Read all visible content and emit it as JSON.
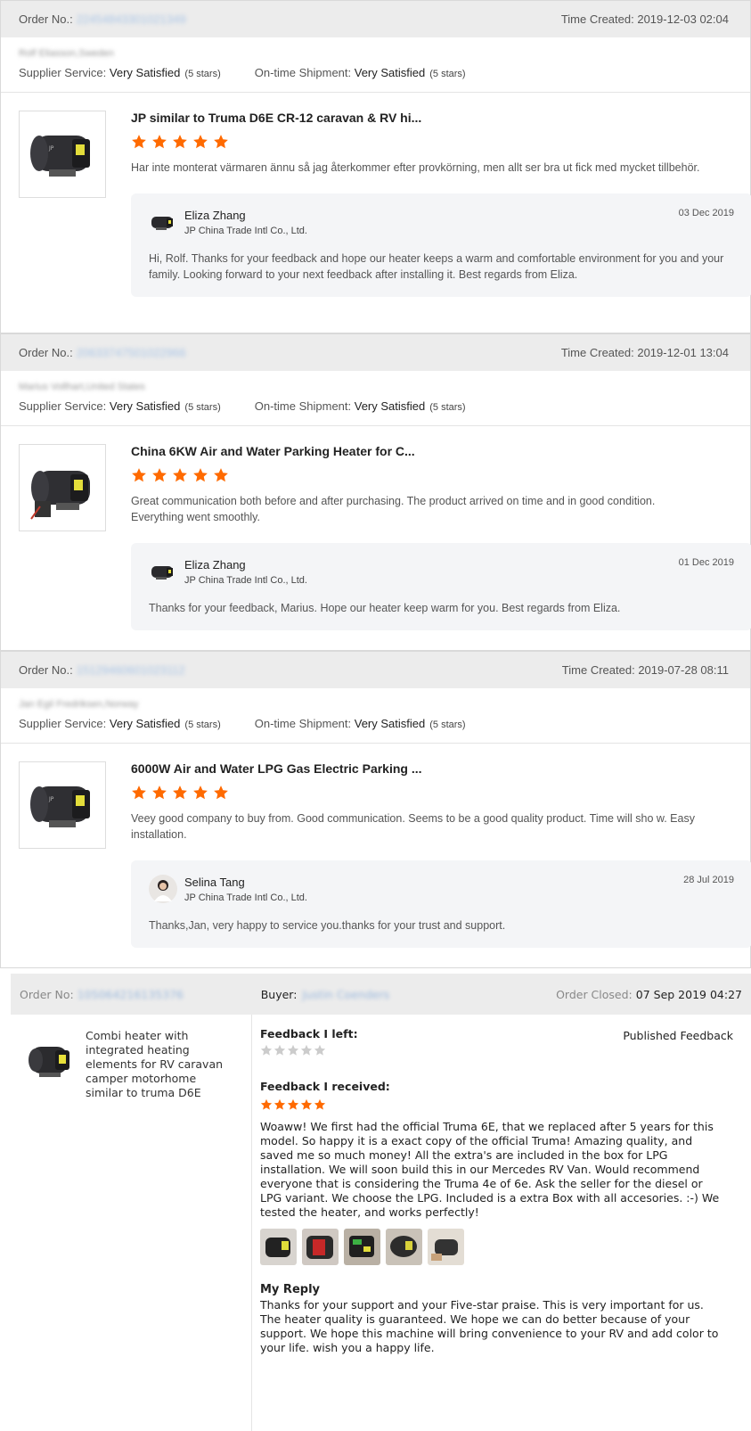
{
  "reviews": [
    {
      "order_label": "Order No.:",
      "order_no": "22454843301021349",
      "time_label": "Time Created:",
      "time_created": "2019-12-03 02:04",
      "buyer": "Rolf Eliasson,Sweden",
      "supplier_label": "Supplier Service:",
      "supplier_value": "Very Satisfied",
      "supplier_stars": "(5 stars)",
      "shipment_label": "On-time Shipment:",
      "shipment_value": "Very Satisfied",
      "shipment_stars": "(5 stars)",
      "product_title": "JP similar to Truma D6E CR-12 caravan & RV hi...",
      "rating": 5,
      "comment": "Har inte monterat värmaren ännu så jag återkommer efter provkörning, men allt ser bra ut fick med mycket tillbehör.",
      "reply_name": "Eliza Zhang",
      "reply_company": "JP China Trade Intl Co., Ltd.",
      "reply_date": "03 Dec 2019",
      "reply_text": "Hi, Rolf. Thanks for your feedback and hope our heater keeps a warm and comfortable environment for you and your family. Looking forward to your next feedback after installing it. Best regards from Eliza."
    },
    {
      "order_label": "Order No.:",
      "order_no": "20633747501022966",
      "time_label": "Time Created:",
      "time_created": "2019-12-01 13:04",
      "buyer": "Marius Vollhart,United States",
      "supplier_label": "Supplier Service:",
      "supplier_value": "Very Satisfied",
      "supplier_stars": "(5 stars)",
      "shipment_label": "On-time Shipment:",
      "shipment_value": "Very Satisfied",
      "shipment_stars": "(5 stars)",
      "product_title": "China 6KW Air and Water Parking Heater for C...",
      "rating": 5,
      "comment": "Great communication both before and after purchasing. The product arrived on time and in good condition. Everything went smoothly.",
      "reply_name": "Eliza Zhang",
      "reply_company": "JP China Trade Intl Co., Ltd.",
      "reply_date": "01 Dec 2019",
      "reply_text": "Thanks for your feedback, Marius. Hope our heater keep warm for you. Best regards from Eliza."
    },
    {
      "order_label": "Order No.:",
      "order_no": "15129460601023112",
      "time_label": "Time Created:",
      "time_created": "2019-07-28 08:11",
      "buyer": "Jan Egil Fredriksen,Norway",
      "supplier_label": "Supplier Service:",
      "supplier_value": "Very Satisfied",
      "supplier_stars": "(5 stars)",
      "shipment_label": "On-time Shipment:",
      "shipment_value": "Very Satisfied",
      "shipment_stars": "(5 stars)",
      "product_title": "6000W Air and Water LPG Gas Electric Parking ...",
      "rating": 5,
      "comment": "Veey good company to buy from. Good communication. Seems to be a good quality product. Time will sho w. Easy installation.",
      "reply_name": "Selina Tang",
      "reply_company": "JP China Trade Intl Co., Ltd.",
      "reply_date": "28 Jul 2019",
      "reply_text": "Thanks,Jan, very happy to service you.thanks for your trust and support."
    }
  ],
  "order2": {
    "order_label": "Order No:",
    "order_no": "105064216135376",
    "buyer_label": "Buyer:",
    "buyer": "Justin Coenders",
    "closed_label": "Order Closed:",
    "closed_date": "07 Sep 2019 04:27",
    "product_name": "Combi heater with integrated heating elements for RV caravan camper motorhome similar to truma D6E",
    "left_label": "Feedback I left:",
    "published": "Published Feedback",
    "left_rating": 0,
    "received_label": "Feedback I received:",
    "received_rating": 5,
    "received_text": "Woaww! We first had the official Truma 6E, that we replaced after 5 years for this model. So happy it is a exact copy of the official Truma! Amazing quality, and saved me so much money! All the extra's are included in the box for LPG installation. We will soon build this in our Mercedes RV Van. Would recommend everyone that is considering the Truma 4e of 6e. Ask the seller for the diesel or LPG variant. We choose the LPG. Included is a extra Box with all accesories. :-) We tested the heater, and works perfectly!",
    "reply_label": "My Reply",
    "reply_text": "Thanks for your support and your Five-star praise. This is very important for us. The heater quality is guaranteed. We hope we can do better because of your support. We hope this machine will bring convenience to your RV and add color to your life. wish you a happy life."
  },
  "colors": {
    "star_orange": "#ff6a00",
    "star_gray": "#cccccc",
    "header_bg": "#ececec",
    "reply_bg": "#f4f5f7"
  },
  "icons": [
    "heater-product-icon",
    "star-icon",
    "avatar-icon"
  ]
}
